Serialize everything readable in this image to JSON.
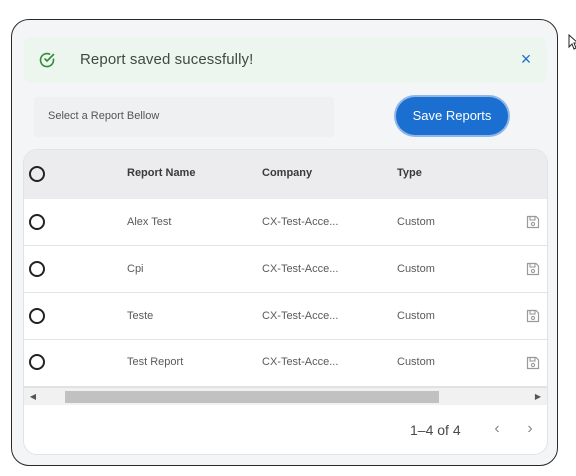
{
  "alert": {
    "message": "Report saved sucessfully!",
    "close_label": "×"
  },
  "toolbar": {
    "select_placeholder": "Select a Report Bellow",
    "save_label": "Save Reports"
  },
  "table": {
    "columns": [
      "Report Name",
      "Company",
      "Type"
    ],
    "rows": [
      {
        "name": "Alex Test",
        "company": "CX-Test-Acce...",
        "type": "Custom"
      },
      {
        "name": "Cpi",
        "company": "CX-Test-Acce...",
        "type": "Custom"
      },
      {
        "name": "Teste",
        "company": "CX-Test-Acce...",
        "type": "Custom"
      },
      {
        "name": "Test Report",
        "company": "CX-Test-Acce...",
        "type": "Custom"
      }
    ]
  },
  "pagination": {
    "range_text": "1–4 of 4",
    "prev_icon": "‹",
    "next_icon": "›"
  },
  "scrollbar": {
    "left_icon": "◀",
    "right_icon": "▶"
  },
  "colors": {
    "accent": "#1a6fd0",
    "alert_bg": "#edf6ee",
    "success_icon": "#2f8a3a"
  }
}
